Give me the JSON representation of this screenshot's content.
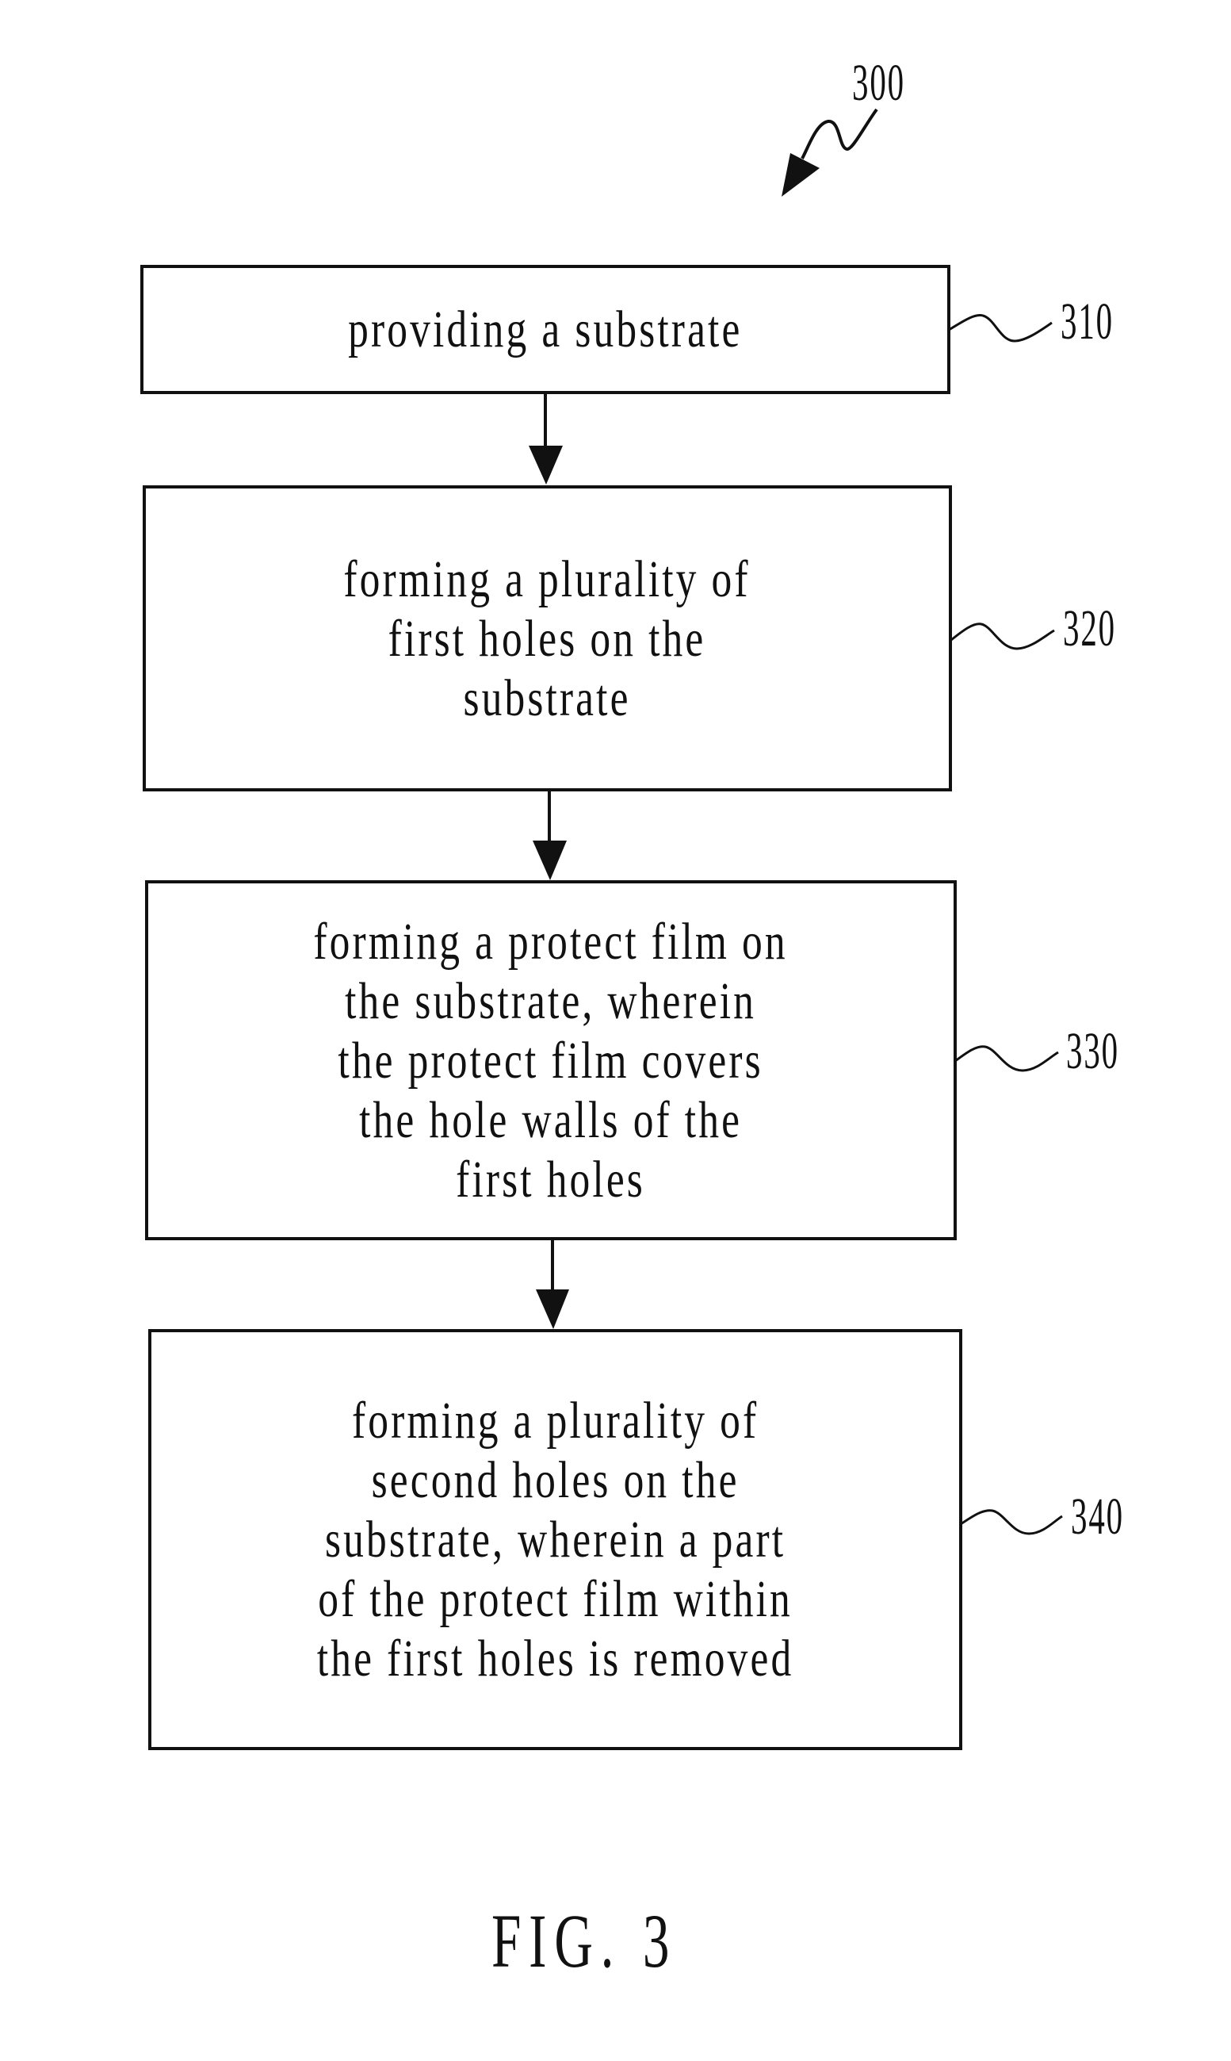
{
  "figure": {
    "reference_number": "300",
    "caption": "FIG. 3"
  },
  "steps": [
    {
      "ref": "310",
      "lines": [
        "providing a substrate"
      ]
    },
    {
      "ref": "320",
      "lines": [
        "forming a plurality of",
        "first holes on the",
        "substrate"
      ]
    },
    {
      "ref": "330",
      "lines": [
        "forming a protect film on",
        "the substrate, wherein",
        "the protect film covers",
        "the hole walls of the",
        "first holes"
      ]
    },
    {
      "ref": "340",
      "lines": [
        "forming a plurality of",
        "second holes on the",
        "substrate, wherein a part",
        "of the protect film within",
        "the first holes is removed"
      ]
    }
  ],
  "colors": {
    "ink": "#111111",
    "background": "#ffffff"
  }
}
